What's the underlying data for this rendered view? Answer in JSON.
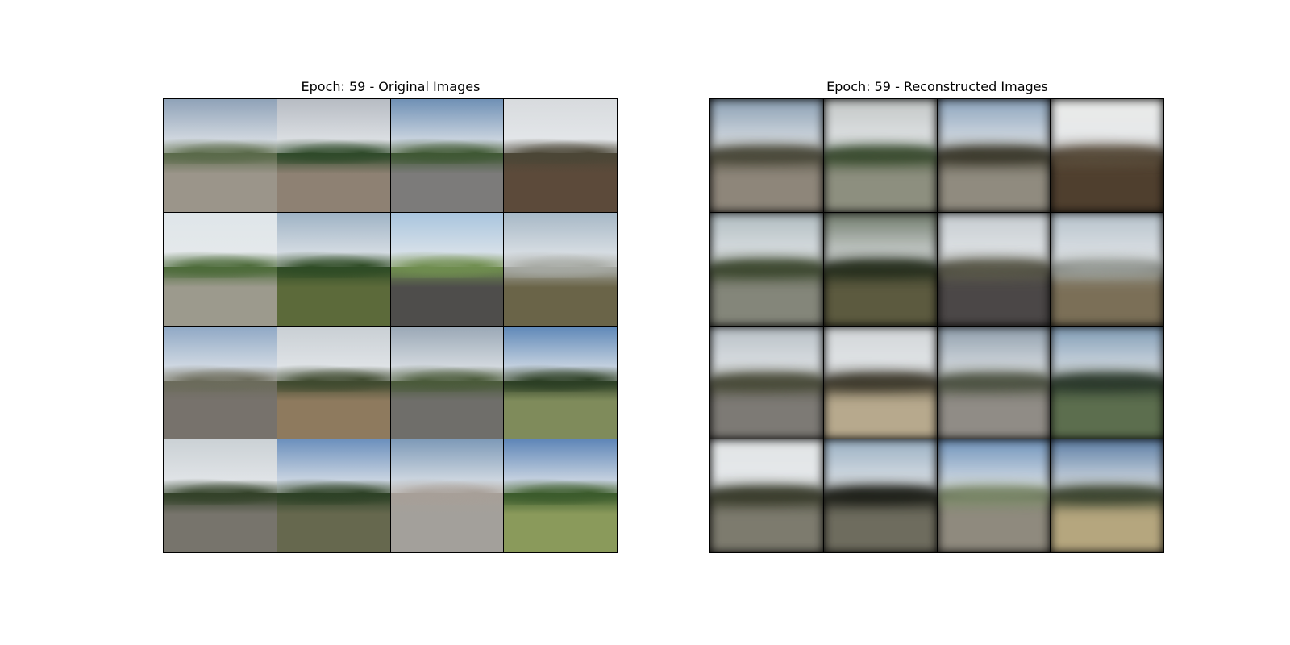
{
  "figure": {
    "left_title": "Epoch: 59 - Original Images",
    "right_title": "Epoch: 59 - Reconstructed Images"
  },
  "palette": {
    "sky_blue": "#7c98b8",
    "sky_grey": "#b9bfc6",
    "sky_white": "#e9ecef",
    "tree_dark": "#2f3a26",
    "grass": "#6f7d4a",
    "road": "#8d877c",
    "field_brown": "#5e4c3a"
  },
  "tiles": {
    "original": [
      {
        "sky": "#8fa2b8",
        "trees": "#5a6a4a",
        "ground": "#9b958a"
      },
      {
        "sky": "#b7bcc3",
        "trees": "#2f4a2a",
        "ground": "#8e8173"
      },
      {
        "sky": "#6f90b5",
        "trees": "#3f5834",
        "ground": "#7c7b7a"
      },
      {
        "sky": "#d8dbde",
        "trees": "#4b4636",
        "ground": "#5c4a3a"
      },
      {
        "sky": "#dfe6e9",
        "trees": "#4d6b3a",
        "ground": "#9c9a8d"
      },
      {
        "sky": "#9fb3c5",
        "trees": "#2e4b25",
        "ground": "#5c6a3a"
      },
      {
        "sky": "#a9c5de",
        "trees": "#6f8d4f",
        "ground": "#4e4d4b"
      },
      {
        "sky": "#a7b8c6",
        "trees": "#a6a9a3",
        "ground": "#6a6448"
      },
      {
        "sky": "#8fa8c5",
        "trees": "#6b6b5b",
        "ground": "#77726c"
      },
      {
        "sky": "#c9cfd4",
        "trees": "#3f4a2f",
        "ground": "#8e7a5e"
      },
      {
        "sky": "#9aa8b6",
        "trees": "#4a5a3a",
        "ground": "#6f6e6a"
      },
      {
        "sky": "#5f88b8",
        "trees": "#2b3e24",
        "ground": "#7f8b5b"
      },
      {
        "sky": "#cbd1d5",
        "trees": "#334229",
        "ground": "#77746c"
      },
      {
        "sky": "#6c90bd",
        "trees": "#2d4126",
        "ground": "#66684e"
      },
      {
        "sky": "#7e9ab8",
        "trees": "#a79f98",
        "ground": "#a3a09b"
      },
      {
        "sky": "#5f86b8",
        "trees": "#3b5b2c",
        "ground": "#8a9a5b"
      }
    ],
    "reconstructed": [
      {
        "sky": "#8a9fb3",
        "trees": "#4b4a3a",
        "ground": "#8e867a"
      },
      {
        "sky": "#c3c7c6",
        "trees": "#3b4e30",
        "ground": "#8d8f7f"
      },
      {
        "sky": "#8ca4bd",
        "trees": "#3c3a2c",
        "ground": "#908b7f"
      },
      {
        "sky": "#e9eae8",
        "trees": "#5b4e3c",
        "ground": "#4f3f2e"
      },
      {
        "sky": "#b0bcc0",
        "trees": "#3e4a30",
        "ground": "#84867a"
      },
      {
        "sky": "#6f7a6a",
        "trees": "#27301e",
        "ground": "#5c5a3f"
      },
      {
        "sky": "#c6ccd0",
        "trees": "#5b5a4a",
        "ground": "#4b4747"
      },
      {
        "sky": "#b6c2cb",
        "trees": "#9ea39e",
        "ground": "#7b6f57"
      },
      {
        "sky": "#b8c0c6",
        "trees": "#4b4d3a",
        "ground": "#7d7a75"
      },
      {
        "sky": "#d2d6d8",
        "trees": "#3e3a2c",
        "ground": "#b7a98d"
      },
      {
        "sky": "#8f9eac",
        "trees": "#4f5544",
        "ground": "#908c86"
      },
      {
        "sky": "#7f9bb5",
        "trees": "#2b3a2c",
        "ground": "#5c6e4e"
      },
      {
        "sky": "#e2e5e6",
        "trees": "#3a3d2c",
        "ground": "#7d7b6e"
      },
      {
        "sky": "#9ab0c3",
        "trees": "#1d1f18",
        "ground": "#6e6c5e"
      },
      {
        "sky": "#6f93bb",
        "trees": "#7d8b6a",
        "ground": "#8f8a7e"
      },
      {
        "sky": "#5c7ea5",
        "trees": "#3c4630",
        "ground": "#b5a67e"
      }
    ]
  }
}
